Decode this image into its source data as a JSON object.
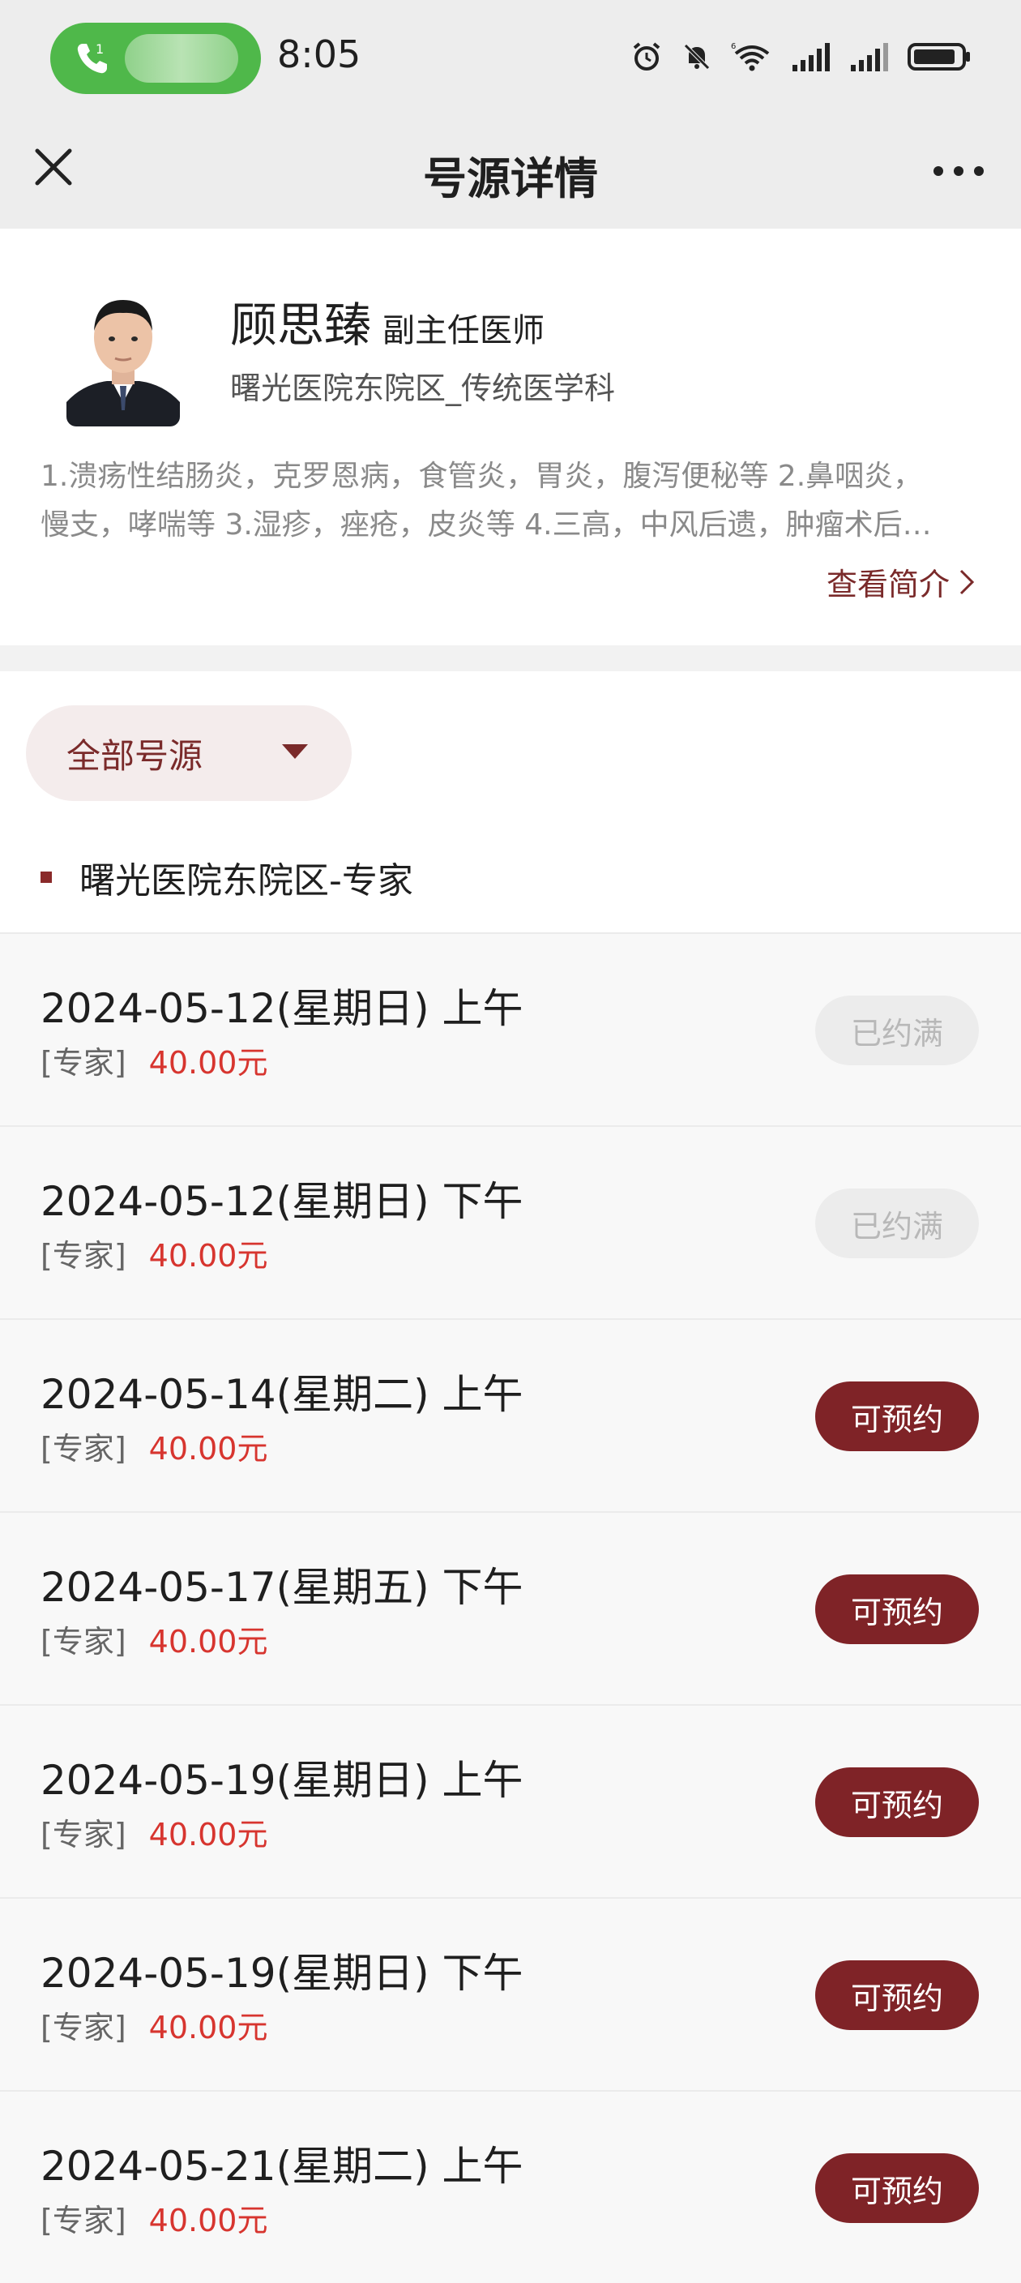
{
  "status_bar": {
    "call_badge": "1",
    "time": "8:05"
  },
  "nav": {
    "title": "号源详情"
  },
  "doctor": {
    "name": "顾思臻",
    "title": "副主任医师",
    "department": "曙光医院东院区_传统医学科",
    "desc_line1": "1.溃疡性结肠炎，克罗恩病，食管炎，胃炎，腹泻便秘等 2.鼻咽炎，",
    "desc_line2": "慢支，哮喘等 3.湿疹，痤疮，皮炎等 4.三高，中风后遗，肿瘤术后…",
    "view_intro": "查看简介"
  },
  "filter": {
    "label": "全部号源"
  },
  "section": {
    "title": "曙光医院东院区-专家"
  },
  "slots": [
    {
      "date": "2024-05-12(星期日) 上午",
      "type": "[专家]",
      "price": "40.00元",
      "status": "已约满"
    },
    {
      "date": "2024-05-12(星期日) 下午",
      "type": "[专家]",
      "price": "40.00元",
      "status": "已约满"
    },
    {
      "date": "2024-05-14(星期二) 上午",
      "type": "[专家]",
      "price": "40.00元",
      "status": "可预约"
    },
    {
      "date": "2024-05-17(星期五) 下午",
      "type": "[专家]",
      "price": "40.00元",
      "status": "可预约"
    },
    {
      "date": "2024-05-19(星期日) 上午",
      "type": "[专家]",
      "price": "40.00元",
      "status": "可预约"
    },
    {
      "date": "2024-05-19(星期日) 下午",
      "type": "[专家]",
      "price": "40.00元",
      "status": "可预约"
    },
    {
      "date": "2024-05-21(星期二) 上午",
      "type": "[专家]",
      "price": "40.00元",
      "status": "可预约"
    }
  ],
  "colors": {
    "accent": "#7f2327",
    "price": "#d7352f",
    "call_pill": "#4fb84a"
  }
}
